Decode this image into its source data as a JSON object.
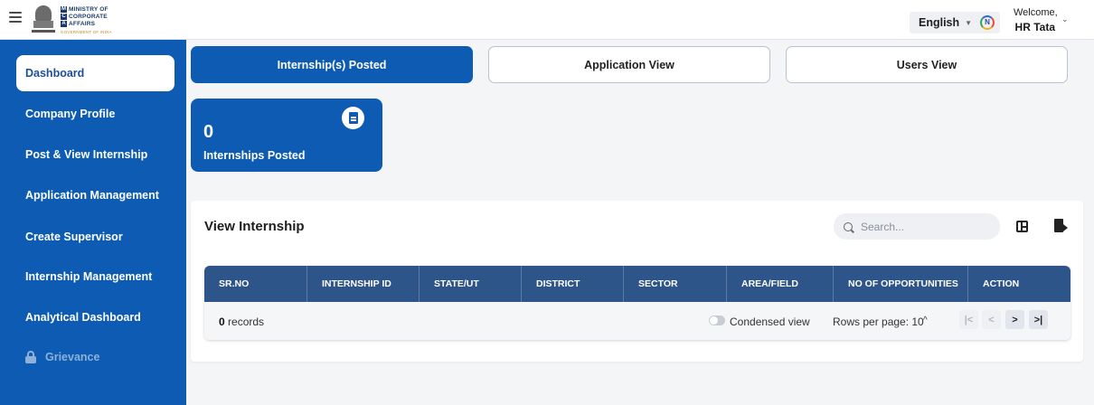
{
  "header": {
    "logo": {
      "line1": "MINISTRY OF",
      "line2": "CORPORATE",
      "line3": "AFFAIRS",
      "sub": "GOVERNMENT OF INDIA",
      "letters": [
        "M",
        "C",
        "A"
      ]
    },
    "language": "English",
    "lang_icon_glyph": "N",
    "welcome_label": "Welcome,",
    "user_name": "HR Tata"
  },
  "sidebar": {
    "items": [
      {
        "label": "Dashboard",
        "active": true
      },
      {
        "label": "Company Profile"
      },
      {
        "label": "Post & View Internship"
      },
      {
        "label": "Application Management"
      },
      {
        "label": "Create Supervisor"
      },
      {
        "label": "Internship Management"
      },
      {
        "label": "Analytical Dashboard"
      },
      {
        "label": "Grievance",
        "disabled": true
      }
    ]
  },
  "tabs": [
    {
      "label": "Internship(s) Posted",
      "active": true
    },
    {
      "label": "Application View"
    },
    {
      "label": "Users View"
    }
  ],
  "stat_card": {
    "value": "0",
    "label": "Internships Posted"
  },
  "panel": {
    "title": "View Internship",
    "search_placeholder": "Search...",
    "columns": [
      "SR.NO",
      "INTERNSHIP ID",
      "STATE/UT",
      "DISTRICT",
      "SECTOR",
      "AREA/FIELD",
      "NO OF OPPORTUNITIES",
      "ACTION"
    ],
    "footer": {
      "record_count": "0",
      "records_label": " records",
      "condensed_label": "Condensed view",
      "rows_per_page": "Rows per page: 10"
    }
  },
  "colors": {
    "primary": "#0d5bb2",
    "table_header": "#2e5589",
    "background": "#f4f5f7"
  },
  "icons": [
    "hamburger-icon",
    "language-icon",
    "chevron-down-icon",
    "document-icon",
    "lock-icon",
    "search-icon",
    "columns-icon",
    "export-icon",
    "first-page-icon",
    "prev-page-icon",
    "next-page-icon",
    "last-page-icon"
  ]
}
